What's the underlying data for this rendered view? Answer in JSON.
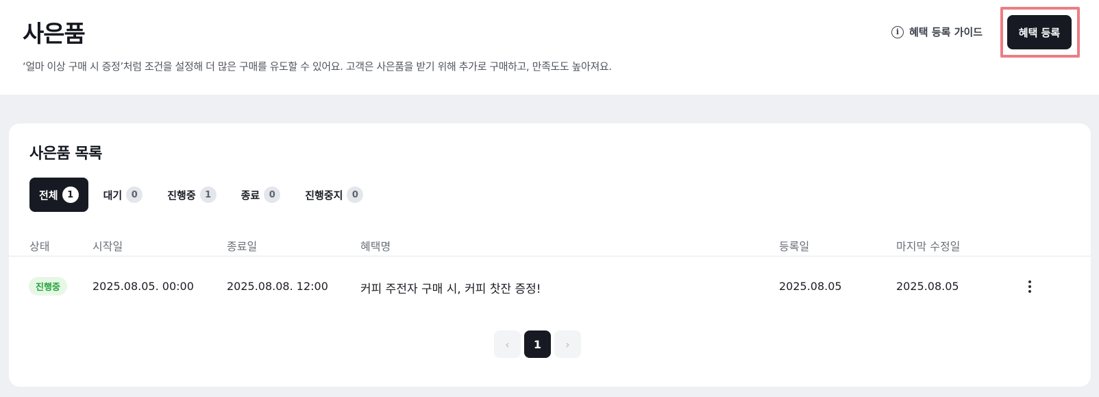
{
  "header": {
    "title": "사은품",
    "description": "‘얼마 이상 구매 시 증정’처럼 조건을 설정해 더 많은 구매를 유도할 수 있어요. 고객은 사은품을 받기 위해 추가로 구매하고, 만족도도 높아져요.",
    "guide_link": "혜택 등록 가이드",
    "info_icon": "i",
    "register_button": "혜택 등록"
  },
  "list": {
    "title": "사은품 목록",
    "tabs": [
      {
        "label": "전체",
        "count": "1",
        "active": true
      },
      {
        "label": "대기",
        "count": "0"
      },
      {
        "label": "진행중",
        "count": "1"
      },
      {
        "label": "종료",
        "count": "0"
      },
      {
        "label": "진행중지",
        "count": "0"
      }
    ],
    "columns": {
      "status": "상태",
      "start": "시작일",
      "end": "종료일",
      "name": "혜택명",
      "registered": "등록일",
      "modified": "마지막 수정일"
    },
    "rows": [
      {
        "status": "진행중",
        "start": "2025.08.05. 00:00",
        "end": "2025.08.08. 12:00",
        "name": "커피 주전자 구매 시, 커피 찻잔 증정!",
        "registered": "2025.08.05",
        "modified": "2025.08.05"
      }
    ]
  },
  "pagination": {
    "prev": "‹",
    "current": "1",
    "next": "›"
  },
  "colors": {
    "primary": "#171a22",
    "status_active_text": "#22a33a",
    "status_active_bg": "#e6f7e6",
    "highlight": "#ec7d84",
    "page_bg": "#eef0f3"
  }
}
